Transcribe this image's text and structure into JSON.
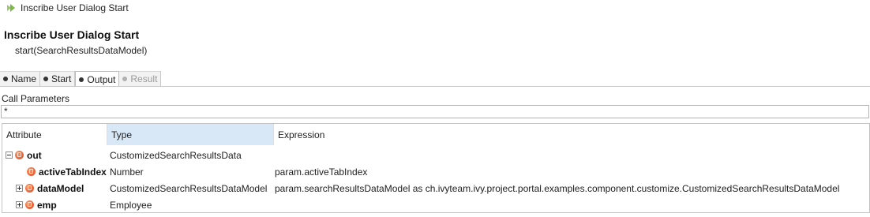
{
  "window": {
    "title": "Inscribe User Dialog Start"
  },
  "header": {
    "heading": "Inscribe User Dialog Start",
    "signature": "start(SearchResultsDataModel)"
  },
  "tabs": [
    {
      "label": "Name",
      "state": "normal"
    },
    {
      "label": "Start",
      "state": "normal"
    },
    {
      "label": "Output",
      "state": "active"
    },
    {
      "label": "Result",
      "state": "disabled"
    }
  ],
  "call_parameters": {
    "label": "Call Parameters",
    "value": "*"
  },
  "table": {
    "columns": [
      "Attribute",
      "Type",
      "Expression"
    ],
    "rows": [
      {
        "attribute": "out",
        "type": "CustomizedSearchResultsData",
        "expression": "",
        "toggle": "expanded"
      },
      {
        "attribute": "activeTabIndex",
        "type": "Number",
        "expression": "param.activeTabIndex",
        "toggle": "none"
      },
      {
        "attribute": "dataModel",
        "type": "CustomizedSearchResultsDataModel",
        "expression": "param.searchResultsDataModel as ch.ivyteam.ivy.project.portal.examples.component.customize.CustomizedSearchResultsDataModel",
        "toggle": "collapsed"
      },
      {
        "attribute": "emp",
        "type": "Employee",
        "expression": "",
        "toggle": "collapsed"
      }
    ]
  },
  "colors": {
    "selected_column_header": "#d9e8f7",
    "attribute_icon": "#d9431b",
    "title_icon": "#7ab648"
  }
}
